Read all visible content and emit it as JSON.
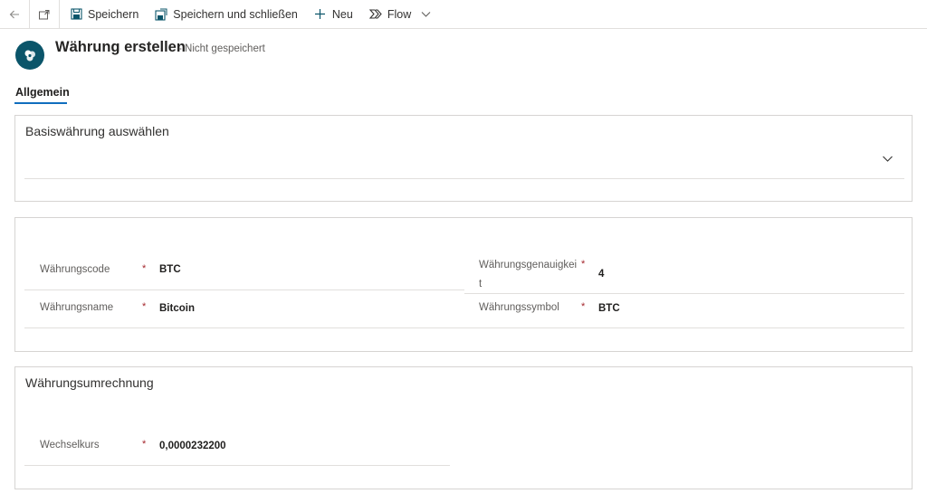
{
  "commandbar": {
    "back_icon": "back-arrow-icon",
    "popout_icon": "open-in-new-window-icon",
    "save_label": "Speichern",
    "save_close_label": "Speichern und schließen",
    "new_label": "Neu",
    "flow_label": "Flow"
  },
  "header": {
    "title": "Währung erstellen",
    "status": "- Nicht gespeichert"
  },
  "tabs": [
    {
      "label": "Allgemein",
      "active": true
    }
  ],
  "base_currency_section": {
    "title": "Basiswährung auswählen"
  },
  "currency_section": {
    "code_label": "Währungscode",
    "code_value": "BTC",
    "name_label": "Währungsname",
    "name_value": "Bitcoin",
    "precision_label": "Währungsgenauigkeit",
    "precision_label_line1": "Währungsgenauigkei",
    "precision_label_line2": "t",
    "precision_value": "4",
    "symbol_label": "Währungssymbol",
    "symbol_value": "BTC",
    "required_marker": "*"
  },
  "conversion_section": {
    "title": "Währungsumrechnung",
    "rate_label": "Wechselkurs",
    "rate_value": "0,0000232200"
  },
  "colors": {
    "accent": "#106ebe",
    "avatar_bg": "#0b556a",
    "required": "#a4262c",
    "border": "#d6d4d2"
  }
}
